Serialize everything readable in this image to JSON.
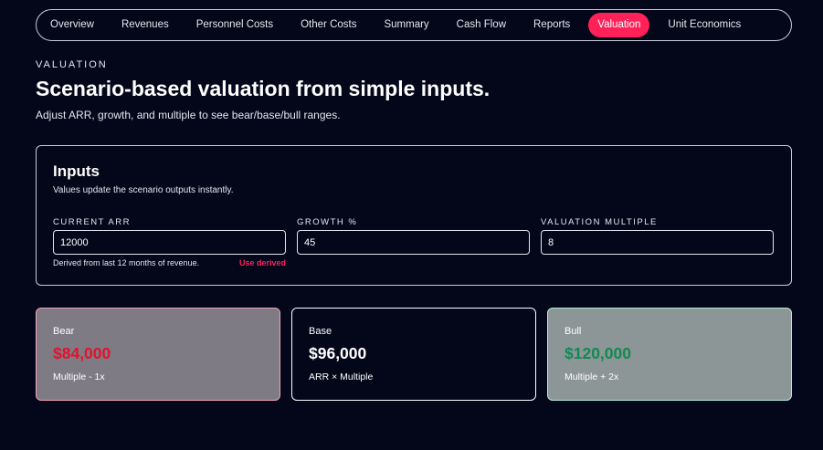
{
  "nav": {
    "tabs": [
      {
        "label": "Overview"
      },
      {
        "label": "Revenues"
      },
      {
        "label": "Personnel Costs"
      },
      {
        "label": "Other Costs"
      },
      {
        "label": "Summary"
      },
      {
        "label": "Cash Flow"
      },
      {
        "label": "Reports"
      },
      {
        "label": "Valuation",
        "active": true
      },
      {
        "label": "Unit Economics"
      }
    ]
  },
  "header": {
    "eyebrow": "VALUATION",
    "title": "Scenario-based valuation from simple inputs.",
    "subtitle": "Adjust ARR, growth, and multiple to see bear/base/bull ranges."
  },
  "inputs": {
    "title": "Inputs",
    "description": "Values update the scenario outputs instantly.",
    "fields": [
      {
        "label": "CURRENT ARR",
        "value": "12000"
      },
      {
        "label": "GROWTH %",
        "value": "45"
      },
      {
        "label": "VALUATION MULTIPLE",
        "value": "8"
      }
    ],
    "hint": "Derived from last 12 months of revenue.",
    "use_derived": "Use derived"
  },
  "scenarios": [
    {
      "name": "Bear",
      "value": "$84,000",
      "note": "Multiple - 1x",
      "color": "#e5112b"
    },
    {
      "name": "Base",
      "value": "$96,000",
      "note": "ARR × Multiple",
      "color": "#ffffff"
    },
    {
      "name": "Bull",
      "value": "$120,000",
      "note": "Multiple + 2x",
      "color": "#0f8a55"
    }
  ],
  "colors": {
    "accent": "#ff2158",
    "background": "#04061a"
  }
}
